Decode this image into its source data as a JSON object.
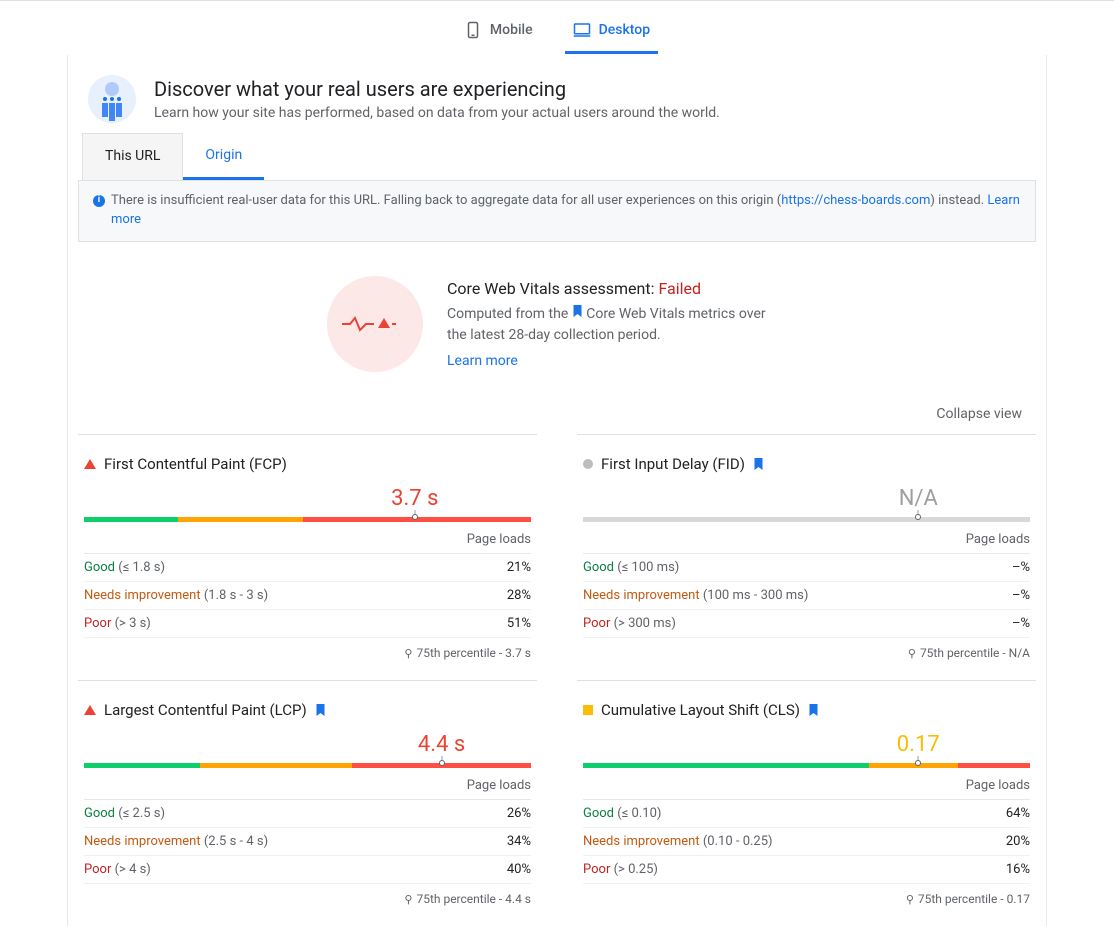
{
  "tabs": {
    "mobile": "Mobile",
    "desktop": "Desktop"
  },
  "header": {
    "title": "Discover what your real users are experiencing",
    "subtitle": "Learn how your site has performed, based on data from your actual users around the world."
  },
  "sourceTabs": {
    "thisUrl": "This URL",
    "origin": "Origin"
  },
  "notice": {
    "pre": "There is insufficient real-user data for this URL. Falling back to aggregate data for all user experiences on this origin (",
    "link": "https://chess-boards.com",
    "post": ") instead. ",
    "learn": "Learn more"
  },
  "assessment": {
    "titlePre": "Core Web Vitals assessment: ",
    "status": "Failed",
    "desc1": "Computed from the ",
    "desc2": " Core Web Vitals metrics over the latest 28-day collection period.",
    "learn": "Learn more"
  },
  "collapse": "Collapse view",
  "pageLoads": "Page loads",
  "metrics": {
    "fcp": {
      "name": "First Contentful Paint (FCP)",
      "value": "3.7 s",
      "segs": [
        21,
        28,
        51
      ],
      "markerPct": 74,
      "good": {
        "label": "Good",
        "range": "(≤ 1.8 s)",
        "pct": "21%"
      },
      "ni": {
        "label": "Needs improvement",
        "range": "(1.8 s - 3 s)",
        "pct": "28%"
      },
      "poor": {
        "label": "Poor",
        "range": "(> 3 s)",
        "pct": "51%"
      },
      "percentile": "75th percentile - 3.7 s"
    },
    "fid": {
      "name": "First Input Delay (FID)",
      "value": "N/A",
      "markerPct": 75,
      "good": {
        "label": "Good",
        "range": "(≤ 100 ms)",
        "pct": "–%"
      },
      "ni": {
        "label": "Needs improvement",
        "range": "(100 ms - 300 ms)",
        "pct": "–%"
      },
      "poor": {
        "label": "Poor",
        "range": "(> 300 ms)",
        "pct": "–%"
      },
      "percentile": "75th percentile - N/A"
    },
    "lcp": {
      "name": "Largest Contentful Paint (LCP)",
      "value": "4.4 s",
      "segs": [
        26,
        34,
        40
      ],
      "markerPct": 80,
      "good": {
        "label": "Good",
        "range": "(≤ 2.5 s)",
        "pct": "26%"
      },
      "ni": {
        "label": "Needs improvement",
        "range": "(2.5 s - 4 s)",
        "pct": "34%"
      },
      "poor": {
        "label": "Poor",
        "range": "(> 4 s)",
        "pct": "40%"
      },
      "percentile": "75th percentile - 4.4 s"
    },
    "cls": {
      "name": "Cumulative Layout Shift (CLS)",
      "value": "0.17",
      "segs": [
        64,
        20,
        16
      ],
      "markerPct": 75,
      "good": {
        "label": "Good",
        "range": "(≤ 0.10)",
        "pct": "64%"
      },
      "ni": {
        "label": "Needs improvement",
        "range": "(0.10 - 0.25)",
        "pct": "20%"
      },
      "poor": {
        "label": "Poor",
        "range": "(> 0.25)",
        "pct": "16%"
      },
      "percentile": "75th percentile - 0.17"
    }
  }
}
